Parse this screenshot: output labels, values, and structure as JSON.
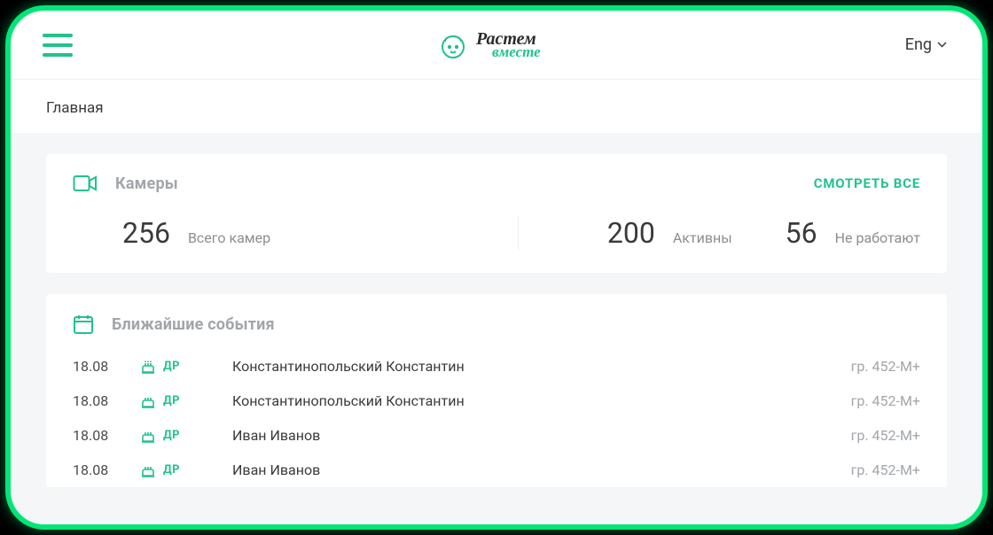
{
  "header": {
    "logo": {
      "line1": "Растем",
      "line2": "вместе"
    },
    "lang": "Eng"
  },
  "breadcrumb": "Главная",
  "cameras": {
    "title": "Камеры",
    "see_all": "СМОТРЕТЬ ВСЕ",
    "stats": [
      {
        "value": "256",
        "label": "Всего камер"
      },
      {
        "value": "200",
        "label": "Активны"
      },
      {
        "value": "56",
        "label": "Не работают"
      }
    ]
  },
  "events": {
    "title": "Ближайшие события",
    "type_label": "ДР",
    "rows": [
      {
        "date": "18.08",
        "name": "Константинопольский Константин",
        "group": "гр. 452-М+"
      },
      {
        "date": "18.08",
        "name": "Константинопольский Константин",
        "group": "гр. 452-М+"
      },
      {
        "date": "18.08",
        "name": "Иван Иванов",
        "group": "гр. 452-М+"
      },
      {
        "date": "18.08",
        "name": "Иван Иванов",
        "group": "гр. 452-М+"
      }
    ]
  }
}
